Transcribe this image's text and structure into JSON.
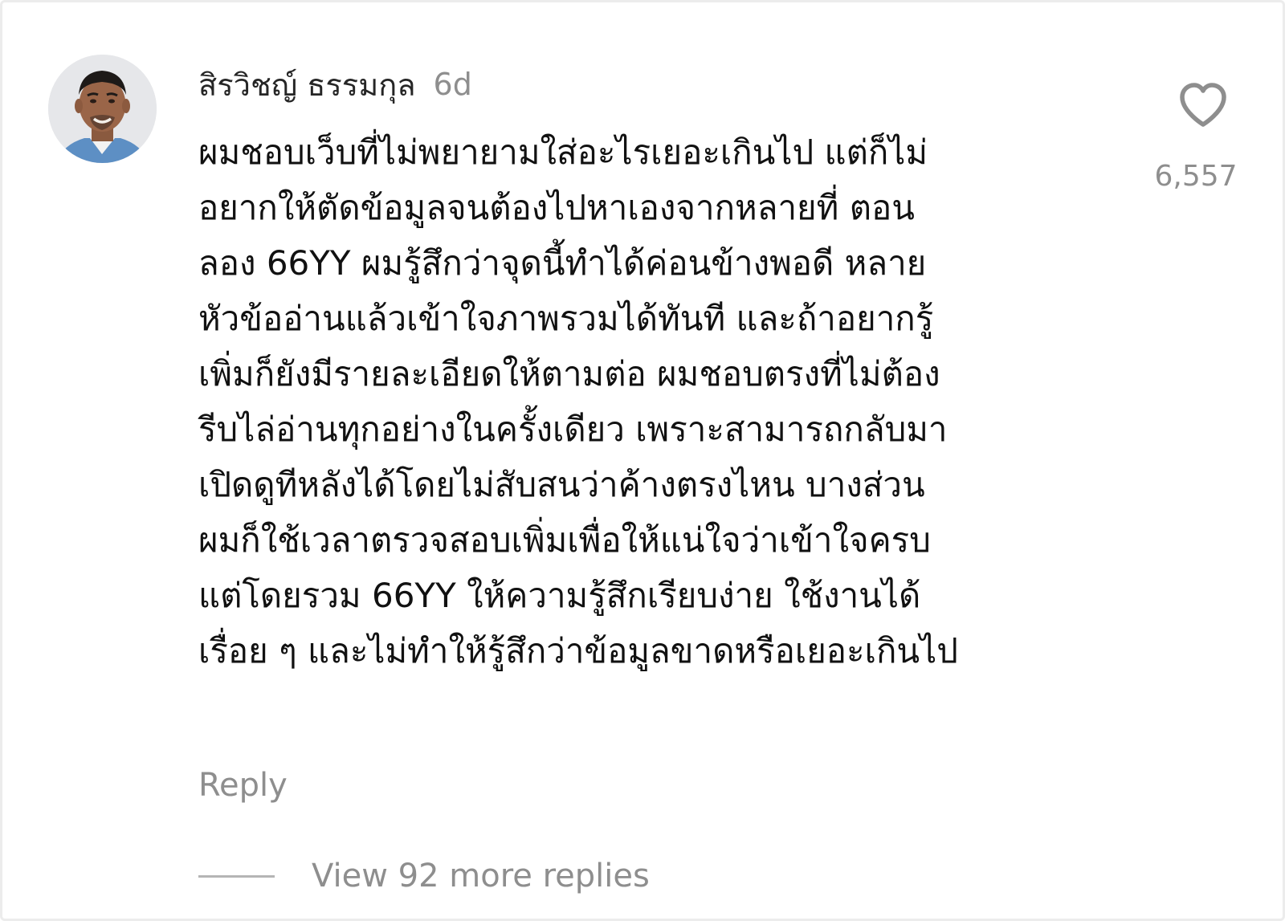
{
  "comment": {
    "avatar_icon": "user-avatar-photo",
    "username": "สิรวิชญ์ ธรรมกุล",
    "timestamp": "6d",
    "lines": [
      "ผมชอบเว็บที่ไม่พยายามใส่อะไรเยอะเกินไป แต่ก็ไม่",
      "อยากให้ตัดข้อมูลจนต้องไปหาเองจากหลายที่ ตอน",
      "ลอง 66YY ผมรู้สึกว่าจุดนี้ทำได้ค่อนข้างพอดี หลาย",
      "หัวข้ออ่านแล้วเข้าใจภาพรวมได้ทันที และถ้าอยากรู้",
      "เพิ่มก็ยังมีรายละเอียดให้ตามต่อ ผมชอบตรงที่ไม่ต้อง",
      "รีบไล่อ่านทุกอย่างในครั้งเดียว เพราะสามารถกลับมา",
      "เปิดดูทีหลังได้โดยไม่สับสนว่าค้างตรงไหน บางส่วน",
      "ผมก็ใช้เวลาตรวจสอบเพิ่มเพื่อให้แน่ใจว่าเข้าใจครบ",
      "แต่โดยรวม 66YY ให้ความรู้สึกเรียบง่าย ใช้งานได้",
      "เรื่อย ๆ และไม่ทำให้รู้สึกว่าข้อมูลขาดหรือเยอะเกินไป"
    ],
    "like_icon": "heart-outline-icon",
    "like_count": "6,557",
    "reply_label": "Reply",
    "view_replies_label": "View 92 more replies"
  },
  "colors": {
    "primary_text": "#111111",
    "secondary_text": "#8e8e8e",
    "divider": "#b5b5b5",
    "heart_stroke": "#8e8e8e"
  }
}
